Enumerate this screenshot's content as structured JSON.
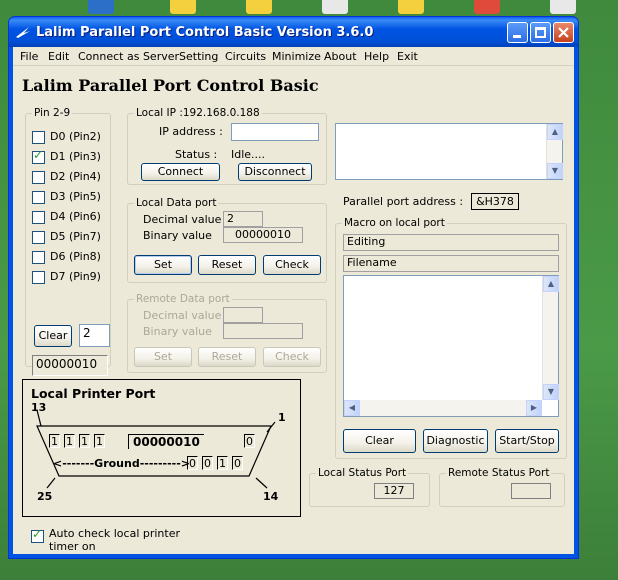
{
  "window": {
    "title": "Lalim Parallel Port Control  Basic    Version 3.6.0",
    "menu": [
      "File",
      "Edit",
      "Connect as Server",
      "Setting",
      "Circuits",
      "Minimize",
      "About",
      "Help",
      "Exit"
    ]
  },
  "app_heading": "Lalim Parallel Port Control Basic",
  "pins": {
    "title": "Pin 2-9",
    "items": [
      {
        "label": "D0  (Pin2)",
        "checked": false
      },
      {
        "label": "D1  (Pin3)",
        "checked": true
      },
      {
        "label": "D2  (Pin4)",
        "checked": false
      },
      {
        "label": "D3  (Pin5)",
        "checked": false
      },
      {
        "label": "D4  (Pin6)",
        "checked": false
      },
      {
        "label": "D5  (Pin7)",
        "checked": false
      },
      {
        "label": "D6  (Pin8)",
        "checked": false
      },
      {
        "label": "D7  (Pin9)",
        "checked": false
      }
    ],
    "clear_label": "Clear",
    "value": "2",
    "binary": "00000010"
  },
  "local_ip": {
    "title": "Local IP  :192.168.0.188",
    "ip_label": "IP address :",
    "ip_value": "",
    "status_label": "Status :",
    "status_value": "Idle....",
    "connect_label": "Connect",
    "disconnect_label": "Disconnect"
  },
  "local_data": {
    "title": "Local Data port",
    "decimal_label": "Decimal value",
    "decimal_value": "2",
    "binary_label": "Binary value",
    "binary_value": "00000010",
    "set_label": "Set",
    "reset_label": "Reset",
    "check_label": "Check"
  },
  "remote_data": {
    "title": "Remote Data port",
    "decimal_label": "Decimal value",
    "binary_label": "Binary value",
    "set_label": "Set",
    "reset_label": "Reset",
    "check_label": "Check"
  },
  "parallel": {
    "label": "Parallel port address  :",
    "value": "&H378"
  },
  "macro": {
    "title": "Macro on local port",
    "editing": "Editing",
    "filename": "Filename",
    "clear_label": "Clear",
    "diagnostic_label": "Diagnostic",
    "startstop_label": "Start/Stop"
  },
  "printer": {
    "title": "Local Printer Port",
    "pin13": "13",
    "pin1": "1",
    "pin25": "25",
    "pin14": "14",
    "status_bits": [
      "1",
      "1",
      "1",
      "1"
    ],
    "data_binary": "00000010",
    "strobe_bit": "0",
    "ground_label": "<-------Ground--------->",
    "control_bits": [
      "0",
      "0",
      "1",
      "0"
    ]
  },
  "local_status": {
    "title": "Local Status Port",
    "value": "127"
  },
  "remote_status": {
    "title": "Remote Status Port",
    "value": ""
  },
  "auto_check": {
    "label_line1": "Auto check local printer",
    "label_line2": "timer on",
    "checked": true
  },
  "colors": {
    "titlebar": "#0054e3",
    "face": "#ece9d8",
    "desktop": "#4a9a48"
  }
}
